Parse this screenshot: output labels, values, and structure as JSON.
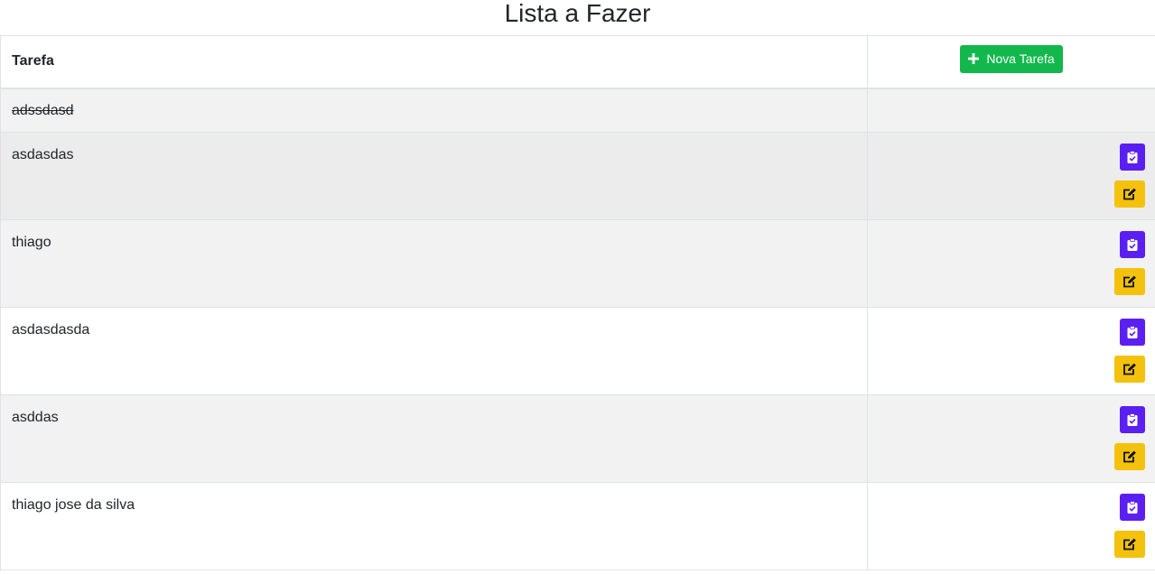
{
  "page": {
    "title": "Lista a Fazer"
  },
  "table": {
    "header_task": "Tarefa",
    "new_task_button": "Nova Tarefa",
    "tasks": [
      {
        "name": "adssdasd",
        "done": true
      },
      {
        "name": "asdasdas",
        "done": false
      },
      {
        "name": "thiago",
        "done": false
      },
      {
        "name": "asdasdasda",
        "done": false
      },
      {
        "name": "asddas",
        "done": false
      },
      {
        "name": "thiago jose da silva",
        "done": false
      }
    ]
  },
  "icons": {
    "new": "plus-icon",
    "complete": "clipboard-check-icon",
    "edit": "edit-icon"
  },
  "colors": {
    "new_button": "#12b84c",
    "complete_button": "#5b1ff2",
    "edit_button": "#f4c20d"
  }
}
